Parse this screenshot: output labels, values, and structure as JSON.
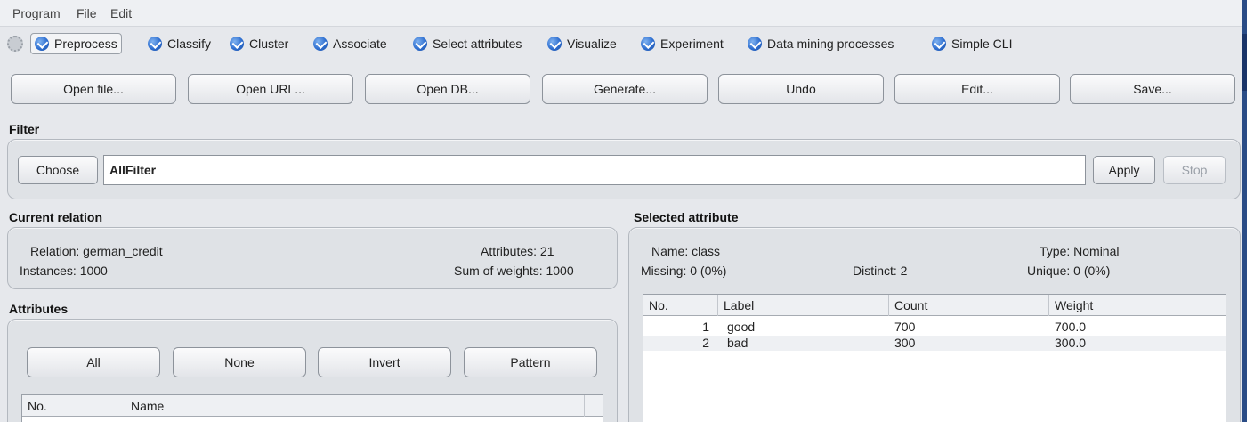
{
  "menubar": {
    "items": [
      "Program",
      "File",
      "Edit"
    ]
  },
  "tabs": [
    {
      "label": "Preprocess",
      "active": true
    },
    {
      "label": "Classify"
    },
    {
      "label": "Cluster"
    },
    {
      "label": "Associate"
    },
    {
      "label": "Select attributes"
    },
    {
      "label": "Visualize"
    },
    {
      "label": "Experiment"
    },
    {
      "label": "Data mining processes"
    },
    {
      "label": "Simple CLI"
    }
  ],
  "toolbar": {
    "open_file": "Open file...",
    "open_url": "Open URL...",
    "open_db": "Open DB...",
    "generate": "Generate...",
    "undo": "Undo",
    "edit": "Edit...",
    "save": "Save..."
  },
  "filter": {
    "title": "Filter",
    "choose": "Choose",
    "value": "AllFilter",
    "apply": "Apply",
    "stop": "Stop"
  },
  "relation": {
    "title": "Current relation",
    "relation_label": "Relation: german_credit",
    "instances_label": "Instances: 1000",
    "attributes_label": "Attributes: 21",
    "weights_label": "Sum of weights: 1000"
  },
  "attributes": {
    "title": "Attributes",
    "all": "All",
    "none": "None",
    "invert": "Invert",
    "pattern": "Pattern",
    "col_no": "No.",
    "col_name": "Name"
  },
  "selected": {
    "title": "Selected attribute",
    "name_label": "Name: class",
    "missing_label": "Missing: 0 (0%)",
    "distinct_label": "Distinct: 2",
    "type_label": "Type: Nominal",
    "unique_label": "Unique: 0 (0%)",
    "columns": [
      "No.",
      "Label",
      "Count",
      "Weight"
    ],
    "rows": [
      {
        "no": "1",
        "label": "good",
        "count": "700",
        "weight": "700.0"
      },
      {
        "no": "2",
        "label": "bad",
        "count": "300",
        "weight": "300.0"
      }
    ]
  }
}
